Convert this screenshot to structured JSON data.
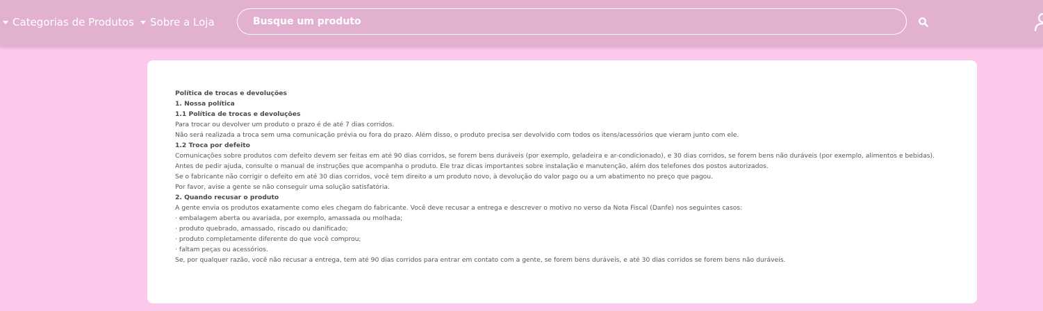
{
  "header": {
    "nav": [
      {
        "label": "Categorias de Produtos"
      },
      {
        "label": "Sobre a Loja"
      }
    ],
    "search": {
      "placeholder": "Busque um produto",
      "icon": "search-icon"
    },
    "user_icon": "user-icon",
    "colors": {
      "bar": "#e2b1cf",
      "page_background": "#fcc8ec",
      "text": "#ffffff"
    }
  },
  "policy": {
    "title": "Política de trocas e devoluções",
    "section1_title": "1. Nossa política",
    "section1_1_title": "1.1 Política de trocas e devoluções",
    "section1_1_p1": "Para trocar ou devolver um produto o prazo é de até 7 dias corridos.",
    "section1_1_p2": "Não será realizada a troca sem uma comunicação prévia ou fora do prazo. Além disso, o produto precisa ser devolvido com todos os itens/acessórios que vieram junto com ele.",
    "section1_2_title": "1.2 Troca por defeito",
    "section1_2_p1": "Comunicações sobre produtos com defeito devem ser feitas em até 90 dias corridos, se forem bens duráveis (por exemplo, geladeira e ar-condicionado), e 30 dias corridos, se forem bens não duráveis (por exemplo, alimentos e bebidas).",
    "section1_2_p2": "Antes de pedir ajuda, consulte o manual de instruções que acompanha o produto. Ele traz dicas importantes sobre instalação e manutenção, além dos telefones dos postos autorizados.",
    "section1_2_p3": "Se o fabricante não corrigir o defeito em até 30 dias corridos, você tem direito a um produto novo, à devolução do valor pago ou a um abatimento no preço que pagou.",
    "section1_2_p4": "Por favor, avise a gente se não conseguir uma solução satisfatória.",
    "section2_title": "2. Quando recusar o produto",
    "section2_p1": "A gente envia os produtos exatamente como eles chegam do fabricante. Você deve recusar a entrega e descrever o motivo no verso da Nota Fiscal (Danfe) nos seguintes casos:",
    "section2_items": [
      "· embalagem aberta ou avariada, por exemplo, amassada ou molhada;",
      "· produto quebrado, amassado, riscado ou danificado;",
      "· produto completamente diferente do que você comprou;",
      "· faltam peças ou acessórios."
    ],
    "section2_p2": "Se, por qualquer razão, você não recusar a entrega, tem até 90 dias corridos para entrar em contato com a gente, se forem bens duráveis, e até 30 dias corridos se forem bens não duráveis."
  }
}
